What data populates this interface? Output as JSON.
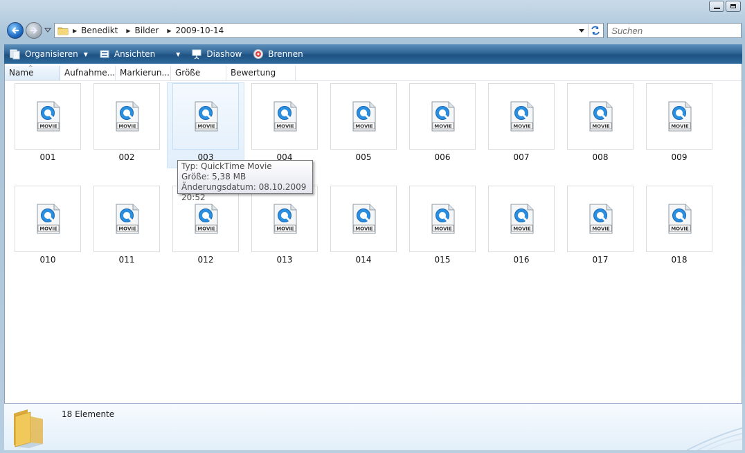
{
  "window": {
    "minimize_icon": "minimize-icon",
    "maximize_icon": "maximize-icon"
  },
  "address_bar": {
    "breadcrumbs": [
      "Benedikt",
      "Bilder",
      "2009-10-14"
    ]
  },
  "search": {
    "placeholder": "Suchen"
  },
  "toolbar": {
    "organize_label": "Organisieren",
    "views_label": "Ansichten",
    "slideshow_label": "Diashow",
    "burn_label": "Brennen"
  },
  "columns": [
    {
      "label": "Name"
    },
    {
      "label": "Aufnahme..."
    },
    {
      "label": "Markierun..."
    },
    {
      "label": "Größe"
    },
    {
      "label": "Bewertung"
    }
  ],
  "files": [
    {
      "name": "001",
      "type_badge": "MOVIE"
    },
    {
      "name": "002",
      "type_badge": "MOVIE"
    },
    {
      "name": "003",
      "type_badge": "MOVIE"
    },
    {
      "name": "004",
      "type_badge": "MOVIE"
    },
    {
      "name": "005",
      "type_badge": "MOVIE"
    },
    {
      "name": "006",
      "type_badge": "MOVIE"
    },
    {
      "name": "007",
      "type_badge": "MOVIE"
    },
    {
      "name": "008",
      "type_badge": "MOVIE"
    },
    {
      "name": "009",
      "type_badge": "MOVIE"
    },
    {
      "name": "010",
      "type_badge": "MOVIE"
    },
    {
      "name": "011",
      "type_badge": "MOVIE"
    },
    {
      "name": "012",
      "type_badge": "MOVIE"
    },
    {
      "name": "013",
      "type_badge": "MOVIE"
    },
    {
      "name": "014",
      "type_badge": "MOVIE"
    },
    {
      "name": "015",
      "type_badge": "MOVIE"
    },
    {
      "name": "016",
      "type_badge": "MOVIE"
    },
    {
      "name": "017",
      "type_badge": "MOVIE"
    },
    {
      "name": "018",
      "type_badge": "MOVIE"
    }
  ],
  "tooltip": {
    "line1": "Typ: QuickTime Movie",
    "line2": "Größe: 5,38 MB",
    "line3": "Änderungsdatum: 08.10.2009 20:52"
  },
  "details": {
    "count": "18 Elemente"
  },
  "colors": {
    "toolbar": "#2f6596",
    "quicktime_blue": "#1e88e5",
    "selection": "#e6f1fb"
  }
}
